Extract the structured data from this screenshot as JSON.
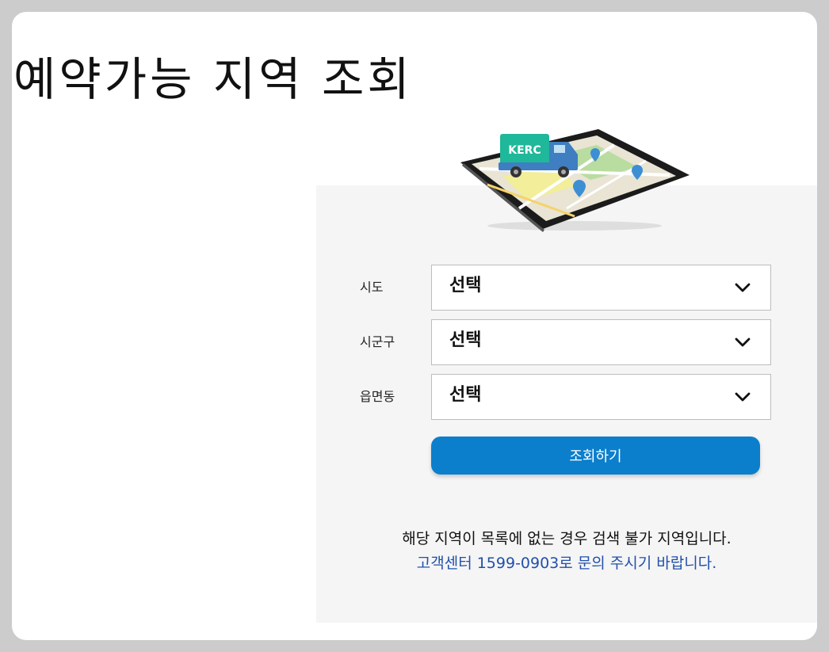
{
  "page": {
    "title": "예약가능 지역 조회"
  },
  "illustration": {
    "truck_label": "KERC"
  },
  "form": {
    "fields": [
      {
        "label": "시도",
        "value": "선택"
      },
      {
        "label": "시군구",
        "value": "선택"
      },
      {
        "label": "읍면동",
        "value": "선택"
      }
    ],
    "submit_label": "조회하기"
  },
  "notice": {
    "line1": "해당 지역이 목록에 없는 경우 검색 불가 지역입니다.",
    "line2": "고객센터 1599-0903로 문의 주시기 바랍니다."
  },
  "colors": {
    "primary_button": "#0b7fcc",
    "notice_link": "#2250a8",
    "panel_bg": "#f5f5f6",
    "truck_cab": "#3f7ec0",
    "truck_sign": "#1fb89a"
  }
}
